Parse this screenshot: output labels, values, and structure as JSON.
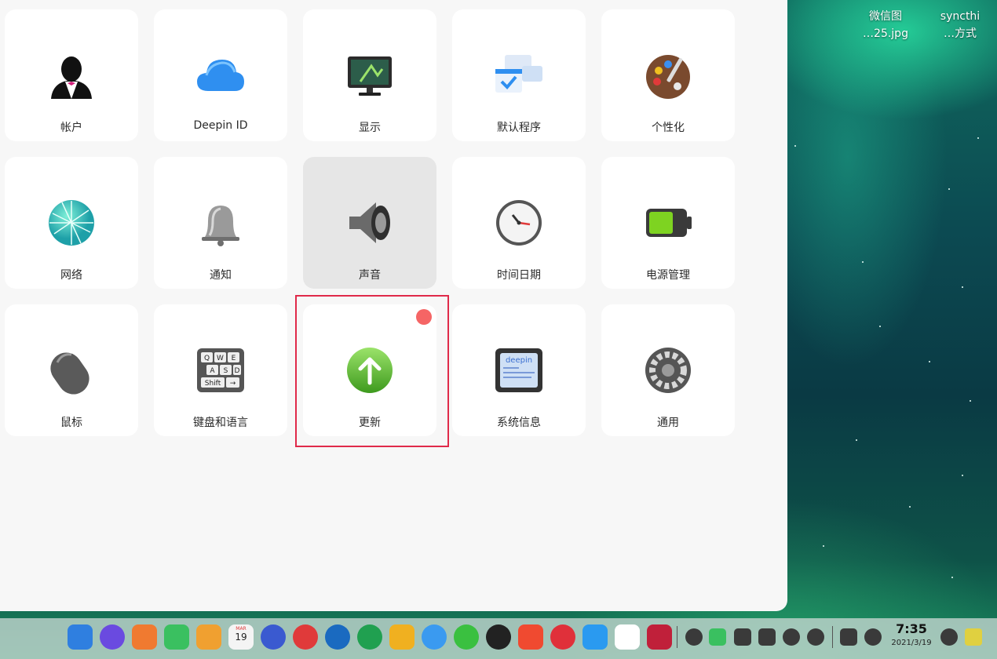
{
  "desktop": {
    "icons": [
      {
        "line1": "微信图",
        "line2": "…25.jpg"
      },
      {
        "line1": "syncthi",
        "line2": "…方式"
      }
    ]
  },
  "control_center": {
    "tiles": [
      {
        "label": "帐户",
        "icon": "account-icon"
      },
      {
        "label": "Deepin ID",
        "icon": "cloud-icon"
      },
      {
        "label": "显示",
        "icon": "display-icon"
      },
      {
        "label": "默认程序",
        "icon": "default-apps-icon"
      },
      {
        "label": "个性化",
        "icon": "palette-icon"
      },
      {
        "label": "网络",
        "icon": "network-globe-icon"
      },
      {
        "label": "通知",
        "icon": "bell-icon"
      },
      {
        "label": "声音",
        "icon": "speaker-icon"
      },
      {
        "label": "时间日期",
        "icon": "clock-icon"
      },
      {
        "label": "电源管理",
        "icon": "battery-icon"
      },
      {
        "label": "鼠标",
        "icon": "mouse-icon"
      },
      {
        "label": "键盘和语言",
        "icon": "keyboard-icon"
      },
      {
        "label": "更新",
        "icon": "update-arrow-icon"
      },
      {
        "label": "系统信息",
        "icon": "system-info-icon"
      },
      {
        "label": "通用",
        "icon": "gear-icon"
      }
    ],
    "keyboard_keys": [
      "Q",
      "W",
      "E",
      "A",
      "S",
      "D",
      "Shift",
      "→"
    ],
    "sysinfo_logo_text": "deepin"
  },
  "taskbar": {
    "clock_time": "7:35",
    "clock_date": "2021/3/19",
    "calendar_month": "MAR",
    "calendar_day": "19"
  },
  "colors": {
    "badge": "#f56565",
    "highlight_border": "#e02a4a",
    "tile_bg": "#ffffff",
    "hover_bg": "#e6e6e6"
  }
}
